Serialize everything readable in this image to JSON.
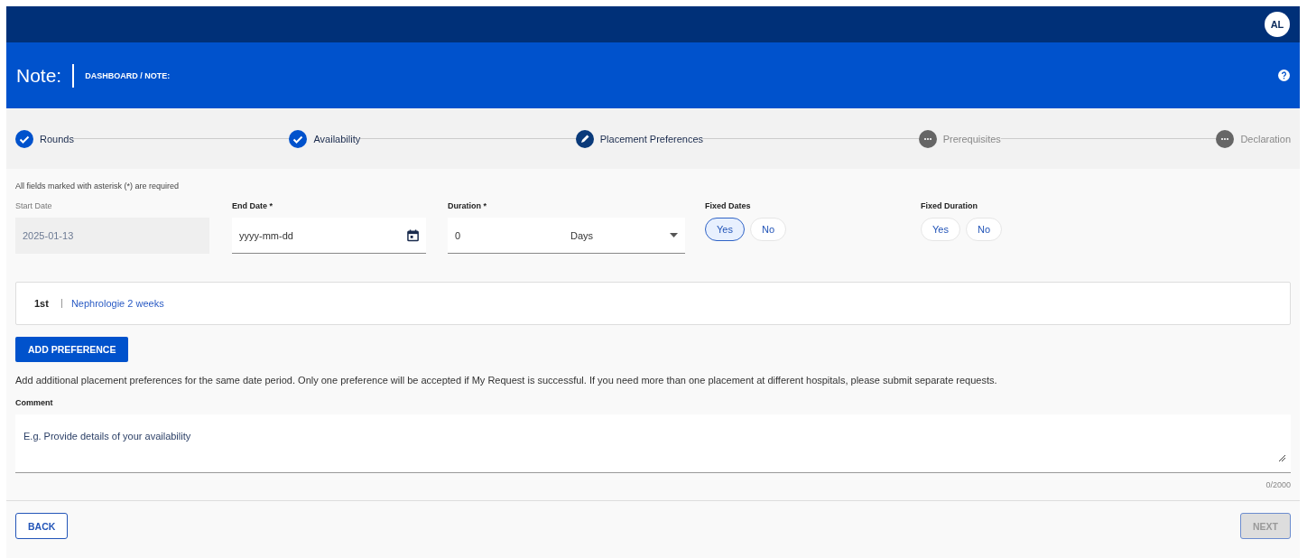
{
  "top_bar": {
    "avatar": "AL"
  },
  "header": {
    "title": "Note:",
    "breadcrumb": "DASHBOARD / NOTE:"
  },
  "steps": [
    {
      "label": "Rounds",
      "kind": "done"
    },
    {
      "label": "Availability",
      "kind": "done"
    },
    {
      "label": "Placement Preferences",
      "kind": "editing"
    },
    {
      "label": "Prerequisites",
      "kind": "pending"
    },
    {
      "label": "Declaration",
      "kind": "pending"
    }
  ],
  "required_note": "All fields marked with asterisk (*) are required",
  "start_date": {
    "label": "Start Date",
    "value": "2025-01-13",
    "disabled": true
  },
  "end_date": {
    "label": "End Date *",
    "placeholder": "yyyy-mm-dd"
  },
  "duration": {
    "label": "Duration *",
    "value": "0",
    "unit": "Days"
  },
  "fixed_dates": {
    "label": "Fixed Dates",
    "options": [
      {
        "label": "Yes",
        "selected": true
      },
      {
        "label": "No",
        "selected": false
      }
    ]
  },
  "fixed_duration": {
    "label": "Fixed Duration",
    "options": [
      {
        "label": "Yes",
        "selected": false
      },
      {
        "label": "No",
        "selected": false
      }
    ]
  },
  "preferences": [
    {
      "rank": "1st",
      "name": "Nephrologie 2 weeks"
    }
  ],
  "add_button": "ADD PREFERENCE",
  "help_text": "Add additional placement preferences for the same date period. Only one preference will be accepted if My Request is successful. If you need more than one placement at different hospitals, please submit separate requests.",
  "comment": {
    "label": "Comment",
    "placeholder": "E.g. Provide details of your availability",
    "counter": "0/2000"
  },
  "back_button": "BACK",
  "next_button": {
    "label": "NEXT",
    "disabled": true
  }
}
